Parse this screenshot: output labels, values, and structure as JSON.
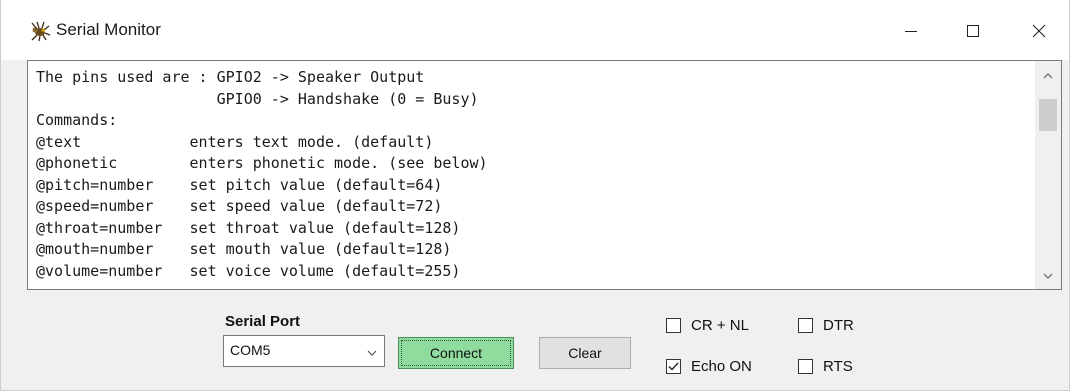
{
  "window": {
    "title": "Serial Monitor",
    "app_icon": "spider-icon"
  },
  "title_buttons": {
    "minimize": "minimize-icon",
    "maximize": "maximize-icon",
    "close": "close-icon"
  },
  "monitor": {
    "lines": [
      "The pins used are : GPIO2 -> Speaker Output",
      "                    GPIO0 -> Handshake (0 = Busy)",
      "Commands:",
      "@text            enters text mode. (default)",
      "@phonetic        enters phonetic mode. (see below)",
      "@pitch=number    set pitch value (default=64)",
      "@speed=number    set speed value (default=72)",
      "@throat=number   set throat value (default=128)",
      "@mouth=number    set mouth value (default=128)",
      "@volume=number   set voice volume (default=255)"
    ],
    "scroll_position": 0.1
  },
  "controls": {
    "serial_port_label": "Serial Port",
    "serial_port_value": "COM5",
    "connect_label": "Connect",
    "clear_label": "Clear",
    "connect_color": "#8fdc9e"
  },
  "options": {
    "cr_nl": {
      "label": "CR + NL",
      "checked": false
    },
    "echo_on": {
      "label": "Echo ON",
      "checked": true
    },
    "dtr": {
      "label": "DTR",
      "checked": false
    },
    "rts": {
      "label": "RTS",
      "checked": false
    }
  }
}
